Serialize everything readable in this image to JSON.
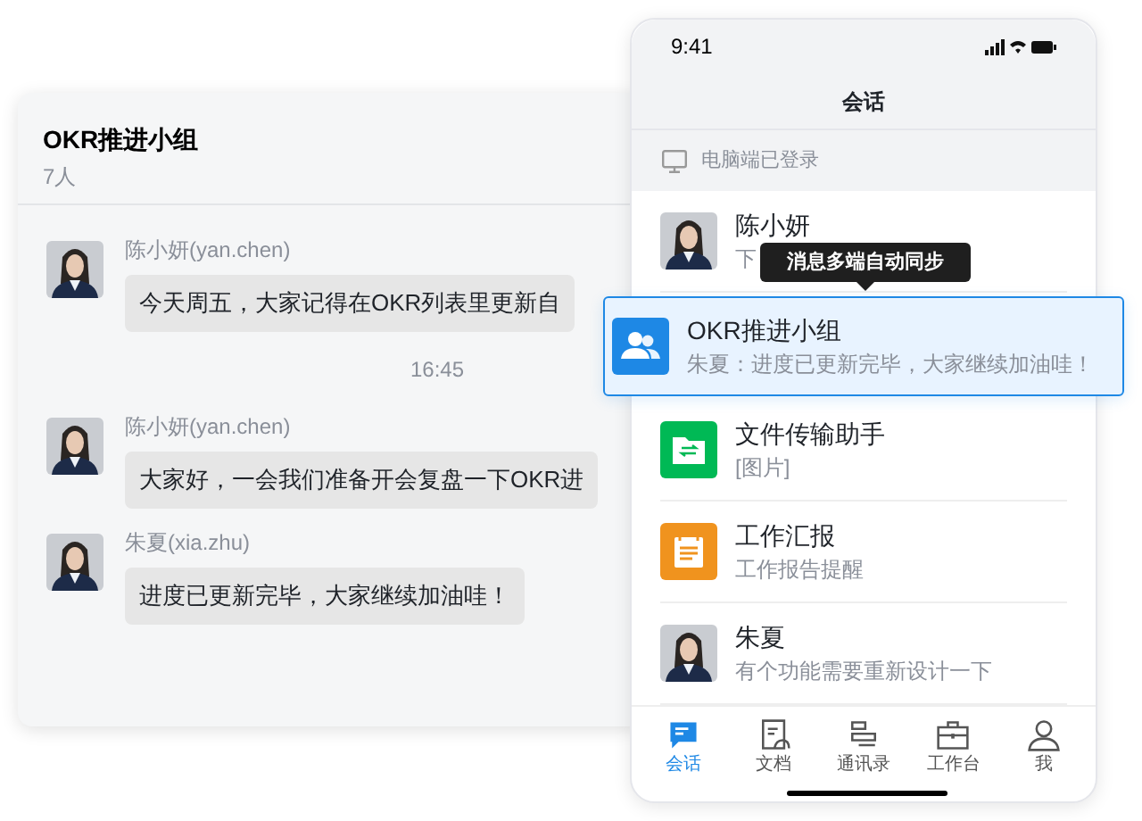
{
  "chat_window": {
    "title": "OKR推进小组",
    "member_count": "7人",
    "messages": [
      {
        "kind": "message",
        "sender": "陈小妍(yan.chen)",
        "text": "今天周五，大家记得在OKR列表里更新自"
      },
      {
        "kind": "time",
        "text": "16:45"
      },
      {
        "kind": "message",
        "sender": "陈小妍(yan.chen)",
        "text": "大家好，一会我们准备开会复盘一下OKR进"
      },
      {
        "kind": "message",
        "sender": "朱夏(xia.zhu)",
        "text": "进度已更新完毕，大家继续加油哇！"
      }
    ]
  },
  "phone": {
    "status_time": "9:41",
    "title": "会话",
    "login_notice": "电脑端已登录",
    "tooltip": "消息多端自动同步",
    "conversations": [
      {
        "kind": "person",
        "name": "陈小妍",
        "preview": "下",
        "highlighted": false
      },
      {
        "kind": "group",
        "name": "OKR推进小组",
        "preview": "朱夏：进度已更新完毕，大家继续加油哇！",
        "highlighted": true
      },
      {
        "kind": "file",
        "name": "文件传输助手",
        "preview": "[图片]",
        "highlighted": false
      },
      {
        "kind": "report",
        "name": "工作汇报",
        "preview": "工作报告提醒",
        "highlighted": false
      },
      {
        "kind": "person",
        "name": "朱夏",
        "preview": "有个功能需要重新设计一下",
        "highlighted": false
      }
    ],
    "tabs": [
      {
        "kind": "chat",
        "label": "会话",
        "selected": true
      },
      {
        "kind": "doc",
        "label": "文档",
        "selected": false
      },
      {
        "kind": "contacts",
        "label": "通讯录",
        "selected": false
      },
      {
        "kind": "work",
        "label": "工作台",
        "selected": false
      },
      {
        "kind": "me",
        "label": "我",
        "selected": false
      }
    ]
  }
}
